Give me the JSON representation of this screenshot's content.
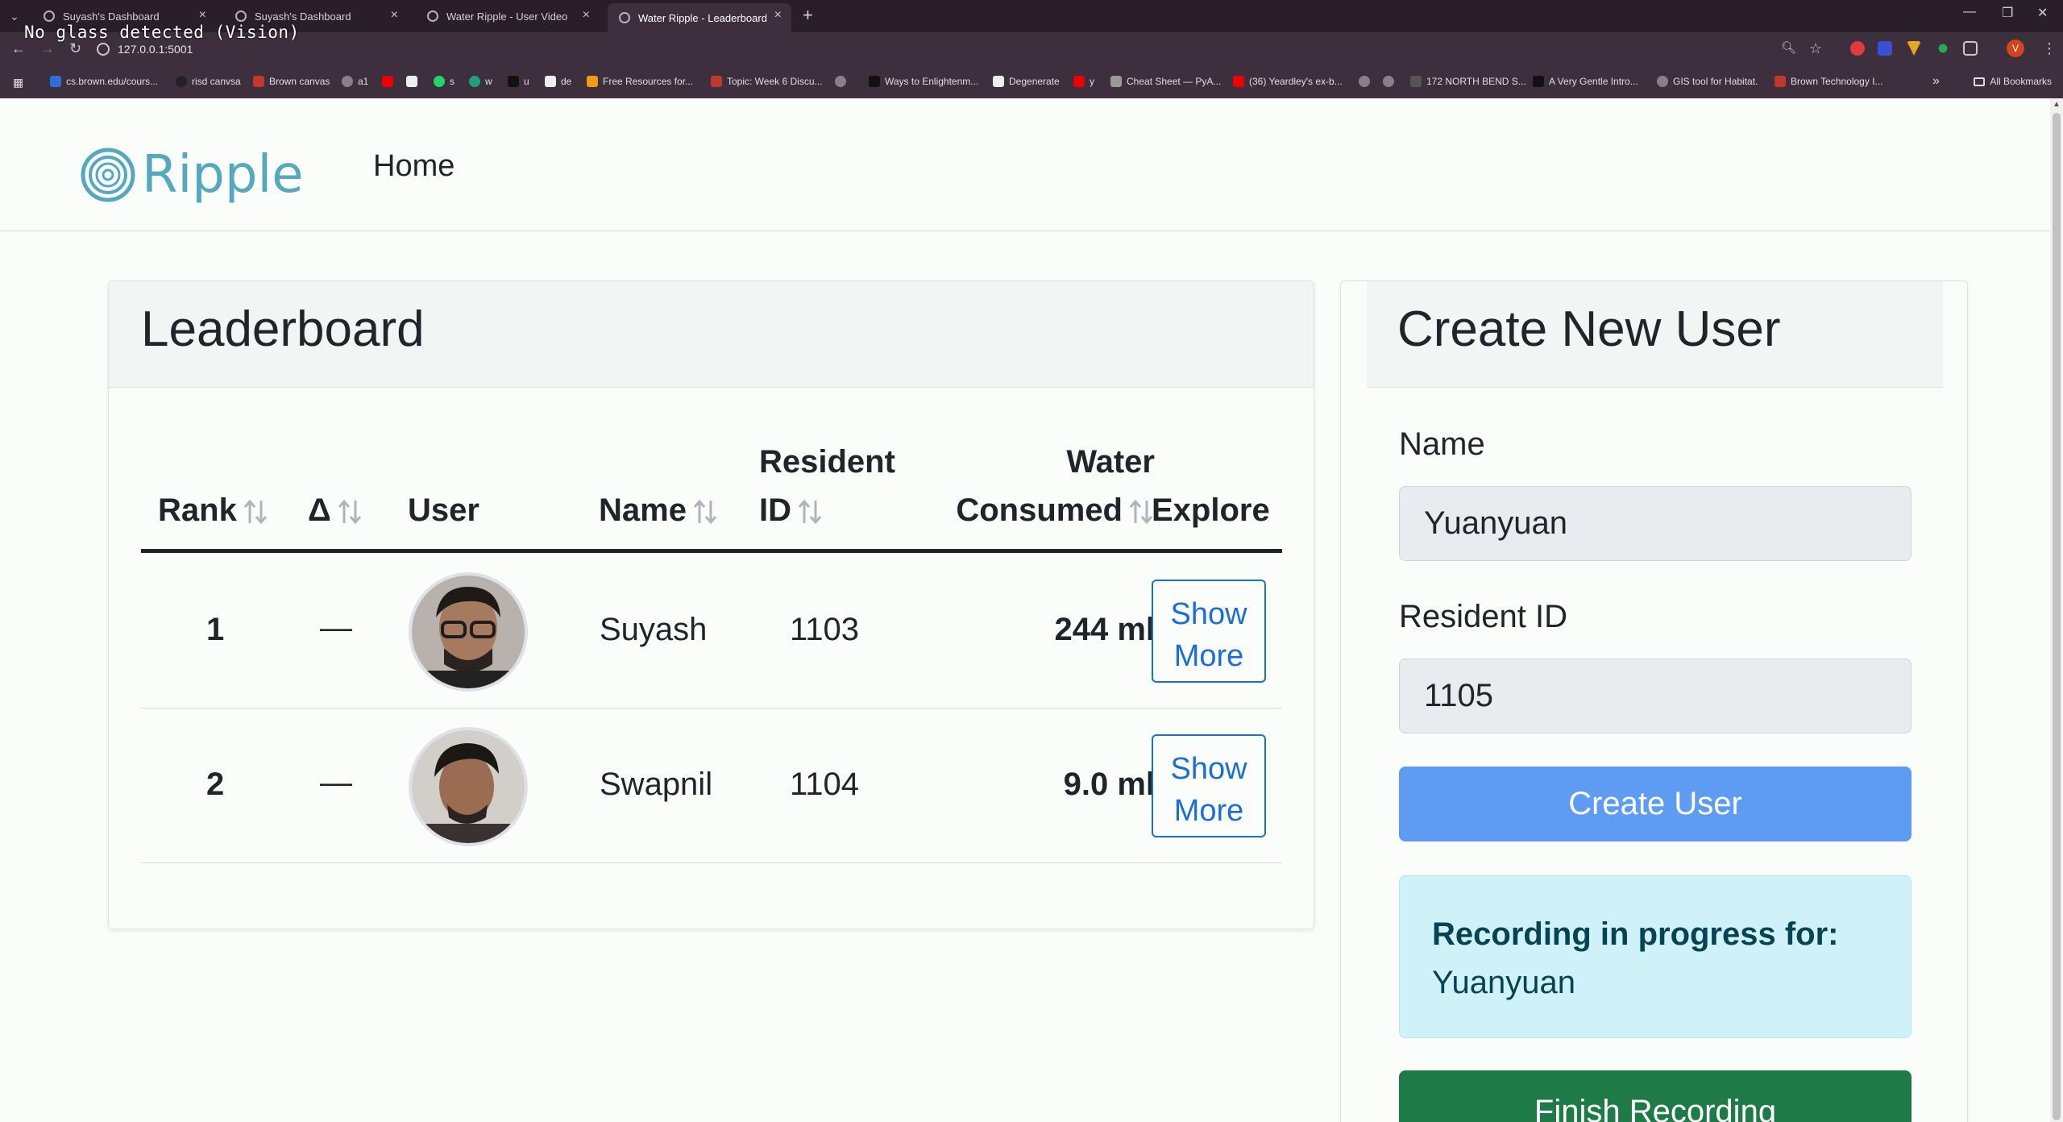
{
  "browser": {
    "tabs": [
      {
        "title": "Suyash's Dashboard",
        "active": false
      },
      {
        "title": "Suyash's Dashboard",
        "active": false
      },
      {
        "title": "Water Ripple - User Video",
        "active": false
      },
      {
        "title": "Water Ripple - Leaderboard",
        "active": true
      }
    ],
    "overlay": "No glass detected (Vision)",
    "url": "127.0.0.1:5001",
    "profile_initial": "V",
    "bookmarks": [
      "cs.brown.edu/cours...",
      "risd canvsa",
      "Brown canvas",
      "a1",
      "",
      "",
      "s",
      "w",
      "u",
      "de",
      "Free Resources for...",
      "Topic: Week 6 Discu...",
      "",
      "Ways to Enlightenm...",
      "Degenerate",
      "y",
      "Cheat Sheet — PyA...",
      "(36) Yeardley's ex-b...",
      "",
      "",
      "172 NORTH BEND S...",
      "A Very Gentle Intro...",
      "GIS tool for Habitat.",
      "Brown Technology I..."
    ],
    "all_bookmarks": "All Bookmarks"
  },
  "nav": {
    "brand": "Ripple",
    "home": "Home"
  },
  "leaderboard": {
    "title": "Leaderboard",
    "columns": {
      "rank": "Rank",
      "delta": "Δ",
      "user": "User",
      "name": "Name",
      "resident_line1": "Resident",
      "resident_line2": "ID",
      "water_line1": "Water",
      "water_line2": "Consumed",
      "explore": "Explore"
    },
    "rows": [
      {
        "rank": "1",
        "delta": "—",
        "name": "Suyash",
        "resident_id": "1103",
        "water": "244 ml",
        "explore_l1": "Show",
        "explore_l2": "More"
      },
      {
        "rank": "2",
        "delta": "—",
        "name": "Swapnil",
        "resident_id": "1104",
        "water": "9.0 ml",
        "explore_l1": "Show",
        "explore_l2": "More"
      }
    ]
  },
  "create_user": {
    "title": "Create New User",
    "name_label": "Name",
    "name_value": "Yuanyuan",
    "resident_label": "Resident ID",
    "resident_value": "1105",
    "create_button": "Create User",
    "recording_title": "Recording in progress for:",
    "recording_name": "Yuanyuan",
    "finish_button": "Finish Recording"
  },
  "colors": {
    "brand": "#56a8bf",
    "primary_button": "#5e9cf4",
    "finish_button": "#1e7a46",
    "link": "#1a6fd6",
    "info_bg": "#cff1f8"
  }
}
